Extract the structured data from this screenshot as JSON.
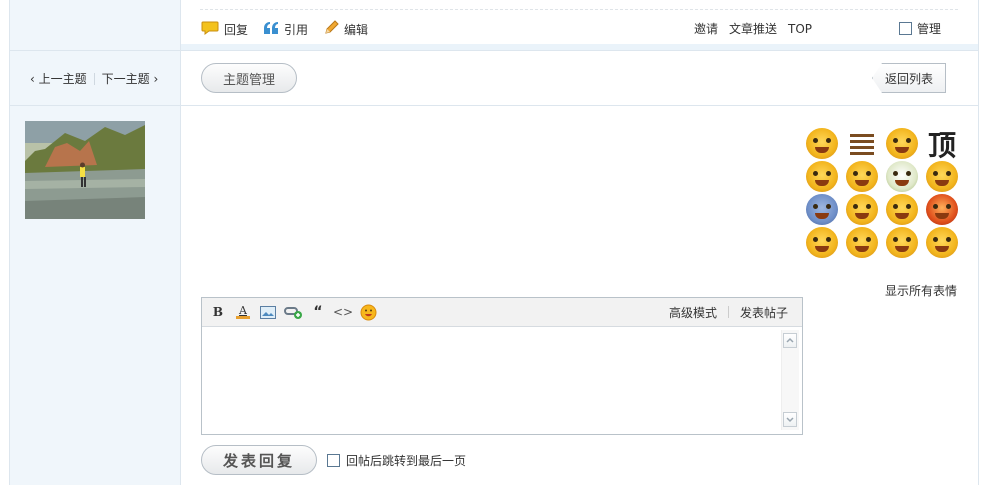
{
  "post_actions": {
    "reply": "回复",
    "quote": "引用",
    "edit": "编辑"
  },
  "post_links": {
    "invite": "邀请",
    "push": "文章推送",
    "top": "TOP",
    "manage": "管理"
  },
  "thread_nav": {
    "prev": "上一主题",
    "next": "下一主题",
    "prev_arrow": "‹",
    "next_arrow": "›"
  },
  "topic_manage": "主题管理",
  "back_to_list": "返回列表",
  "smilies": {
    "show_all": "显示所有表情",
    "text_emote": "顶"
  },
  "editor": {
    "toolbar_buttons": [
      "bold",
      "font-color",
      "image",
      "link",
      "quote",
      "code",
      "smiley"
    ],
    "bold_label": "B",
    "font_color_label": "A",
    "quote_label": "“",
    "code_label": "<>",
    "advanced_mode": "高级模式",
    "post_thread": "发表帖子",
    "content": ""
  },
  "submit": {
    "button_label": "发表回复",
    "jump_label": "回帖后跳转到最后一页"
  },
  "colors": {
    "accent_blue": "#4a84c2",
    "sidebar_bg": "#f0f6fb",
    "border": "#dde6ee"
  }
}
